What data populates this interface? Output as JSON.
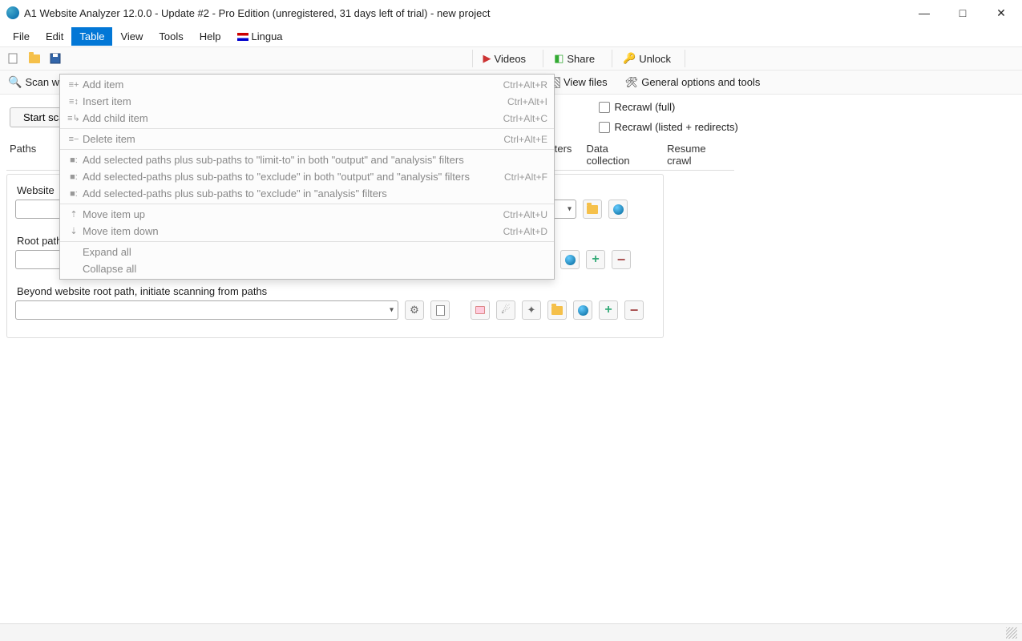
{
  "title": "A1 Website Analyzer 12.0.0 - Update #2 - Pro Edition (unregistered, 31 days left of trial) - new project",
  "menu": [
    "File",
    "Edit",
    "Table",
    "View",
    "Tools",
    "Help",
    "Lingua"
  ],
  "menu_active_index": 2,
  "toolbar2": {
    "scan": "Scan website",
    "view_files": "View files",
    "options": "General options and tools"
  },
  "toolbar_big": {
    "videos": "Videos",
    "share": "Share",
    "unlock": "Unlock"
  },
  "main": {
    "start_btn": "Start scan",
    "recrawl_full": "Recrawl (full)",
    "recrawl_listed": "Recrawl (listed + redirects)"
  },
  "tabs": [
    "Paths",
    "filters",
    "Data collection",
    "Resume crawl"
  ],
  "labels": {
    "website": "Website",
    "root_path": "Root path",
    "beyond": "Beyond website root path, initiate scanning from paths"
  },
  "dropdown": [
    {
      "icon": "≡+",
      "label": "Add item",
      "short": "Ctrl+Alt+R"
    },
    {
      "icon": "≡↕",
      "label": "Insert item",
      "short": "Ctrl+Alt+I"
    },
    {
      "icon": "≡↳",
      "label": "Add child item",
      "short": "Ctrl+Alt+C"
    },
    {
      "sep": true
    },
    {
      "icon": "≡−",
      "label": "Delete item",
      "short": "Ctrl+Alt+E"
    },
    {
      "sep": true
    },
    {
      "icon": "■:",
      "label": "Add selected paths plus sub-paths to \"limit-to\" in both \"output\" and \"analysis\" filters",
      "short": ""
    },
    {
      "icon": "■:",
      "label": "Add selected-paths plus sub-paths to \"exclude\" in both \"output\" and \"analysis\" filters",
      "short": "Ctrl+Alt+F"
    },
    {
      "icon": "■:",
      "label": "Add selected-paths plus sub-paths to \"exclude\" in \"analysis\" filters",
      "short": ""
    },
    {
      "sep": true
    },
    {
      "icon": "⇡",
      "label": "Move item up",
      "short": "Ctrl+Alt+U"
    },
    {
      "icon": "⇣",
      "label": "Move item down",
      "short": "Ctrl+Alt+D"
    },
    {
      "sep": true
    },
    {
      "icon": "",
      "label": "Expand all",
      "short": ""
    },
    {
      "icon": "",
      "label": "Collapse all",
      "short": ""
    }
  ]
}
